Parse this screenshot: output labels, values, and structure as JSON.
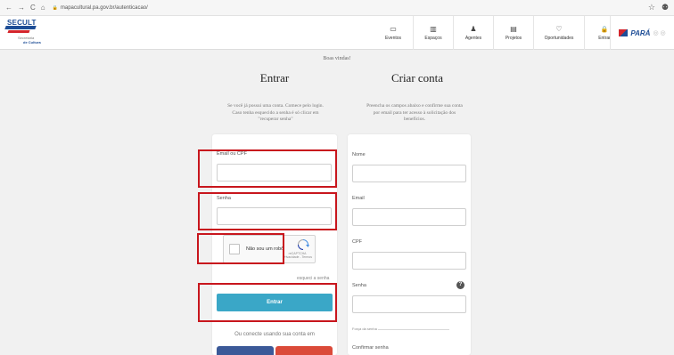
{
  "browser": {
    "url": "mapacultural.pa.gov.br/autenticacao/",
    "nav_back": "←",
    "nav_forward": "→",
    "nav_reload": "C",
    "nav_home": "⌂",
    "lock": "🔒",
    "star": "☆",
    "profile": "⚉"
  },
  "header": {
    "logo_brand": "SECULT",
    "logo_sub1": "Secretaria",
    "logo_sub2": "de Cultura",
    "nav": [
      {
        "label": "Eventos",
        "glyph": "▭"
      },
      {
        "label": "Espaços",
        "glyph": "▥"
      },
      {
        "label": "Agentes",
        "glyph": "♟"
      },
      {
        "label": "Projetos",
        "glyph": "▤"
      },
      {
        "label": "Oportunidades",
        "glyph": "♡"
      },
      {
        "label": "Entrar",
        "glyph": "🔒"
      }
    ],
    "gov_logo": "PARÁ",
    "gov_dots": "◎ ◎"
  },
  "main": {
    "welcome": "Boas vindas!",
    "login": {
      "title": "Entrar",
      "desc1": "Se você já possui uma conta. Comece pelo login.",
      "desc2": "Caso tenha esquecido a senha é só clicar em",
      "desc3": "\"recuperar senha\"",
      "email_label": "Email ou CPF",
      "email_value": "",
      "password_label": "Senha",
      "password_value": "",
      "captcha_label": "Não sou um robô",
      "captcha_brand": "reCAPTCHA",
      "captcha_terms": "Privacidade - Termos",
      "forgot": "esqueci a senha",
      "submit": "Entrar",
      "social_text": "Ou conecte usando sua conta em"
    },
    "signup": {
      "title": "Criar conta",
      "desc1": "Preencha os campos abaixo e confirme sua conta",
      "desc2": "por email para ter acesso à solicitação dos",
      "desc3": "benefícios.",
      "name_label": "Nome",
      "email_label": "Email",
      "cpf_label": "CPF",
      "password_label": "Senha",
      "help": "?",
      "strength_label": "Força da senha",
      "confirm_label": "Confirmar senha"
    }
  },
  "colors": {
    "highlight": "#c8161d",
    "primary": "#3aa7c7",
    "facebook": "#3b5998",
    "google": "#db4a39"
  }
}
